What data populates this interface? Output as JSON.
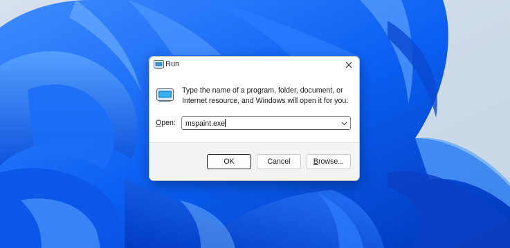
{
  "dialog": {
    "title": "Run",
    "close_glyph": "✕",
    "icon": "run-icon",
    "message": "Type the name of a program, folder, document, or Internet resource, and Windows will open it for you.",
    "open_label_access": "O",
    "open_label_rest": "pen:",
    "open_value": "mspaint.exe",
    "buttons": {
      "ok": "OK",
      "cancel": "Cancel",
      "browse_access": "B",
      "browse_rest": "rowse..."
    }
  },
  "colors": {
    "wallpaper_light": "#cfdbe9",
    "wallpaper_blue": "#0a5cf0",
    "dialog_bg": "#ffffff",
    "footer_bg": "#f3f3f3"
  }
}
